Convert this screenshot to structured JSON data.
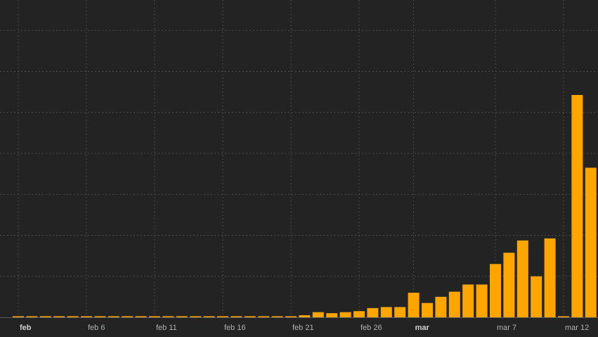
{
  "chart_data": {
    "type": "bar",
    "title": "",
    "xlabel": "",
    "ylabel": "",
    "grid": true,
    "ylim": [
      0,
      1100
    ],
    "bar_color": "#FFA500",
    "background_color": "#232323",
    "grid_color": "#4a4a4a",
    "x": [
      "2020-02-01",
      "2020-02-02",
      "2020-02-03",
      "2020-02-04",
      "2020-02-05",
      "2020-02-06",
      "2020-02-07",
      "2020-02-08",
      "2020-02-09",
      "2020-02-10",
      "2020-02-11",
      "2020-02-12",
      "2020-02-13",
      "2020-02-14",
      "2020-02-15",
      "2020-02-16",
      "2020-02-17",
      "2020-02-18",
      "2020-02-19",
      "2020-02-20",
      "2020-02-21",
      "2020-02-22",
      "2020-02-23",
      "2020-02-24",
      "2020-02-25",
      "2020-02-26",
      "2020-02-27",
      "2020-02-28",
      "2020-02-29",
      "2020-03-01",
      "2020-03-02",
      "2020-03-03",
      "2020-03-04",
      "2020-03-05",
      "2020-03-06",
      "2020-03-07",
      "2020-03-08",
      "2020-03-09",
      "2020-03-10",
      "2020-03-11",
      "2020-03-12",
      "2020-03-13",
      "2020-03-14"
    ],
    "values": [
      0,
      0,
      0,
      0,
      0,
      0,
      0,
      0,
      0,
      0,
      0,
      0,
      0,
      0,
      0,
      0,
      0,
      0,
      0,
      0,
      5,
      10,
      25,
      20,
      25,
      30,
      45,
      50,
      50,
      120,
      70,
      100,
      125,
      160,
      160,
      260,
      315,
      375,
      200,
      385,
      0,
      1085,
      730
    ],
    "tick_labels": [
      {
        "x": "2020-02-01",
        "label": "feb",
        "bold": true
      },
      {
        "x": "2020-02-06",
        "label": "feb 6",
        "bold": false
      },
      {
        "x": "2020-02-11",
        "label": "feb 11",
        "bold": false
      },
      {
        "x": "2020-02-16",
        "label": "feb 16",
        "bold": false
      },
      {
        "x": "2020-02-21",
        "label": "feb 21",
        "bold": false
      },
      {
        "x": "2020-02-26",
        "label": "feb 26",
        "bold": false
      },
      {
        "x": "2020-03-01",
        "label": "mar",
        "bold": true
      },
      {
        "x": "2020-03-07",
        "label": "mar 7",
        "bold": false
      },
      {
        "x": "2020-03-12",
        "label": "mar 12",
        "bold": false
      }
    ],
    "y_grid_values": [
      0,
      200,
      400,
      600,
      800,
      1000,
      1200,
      1400
    ]
  }
}
